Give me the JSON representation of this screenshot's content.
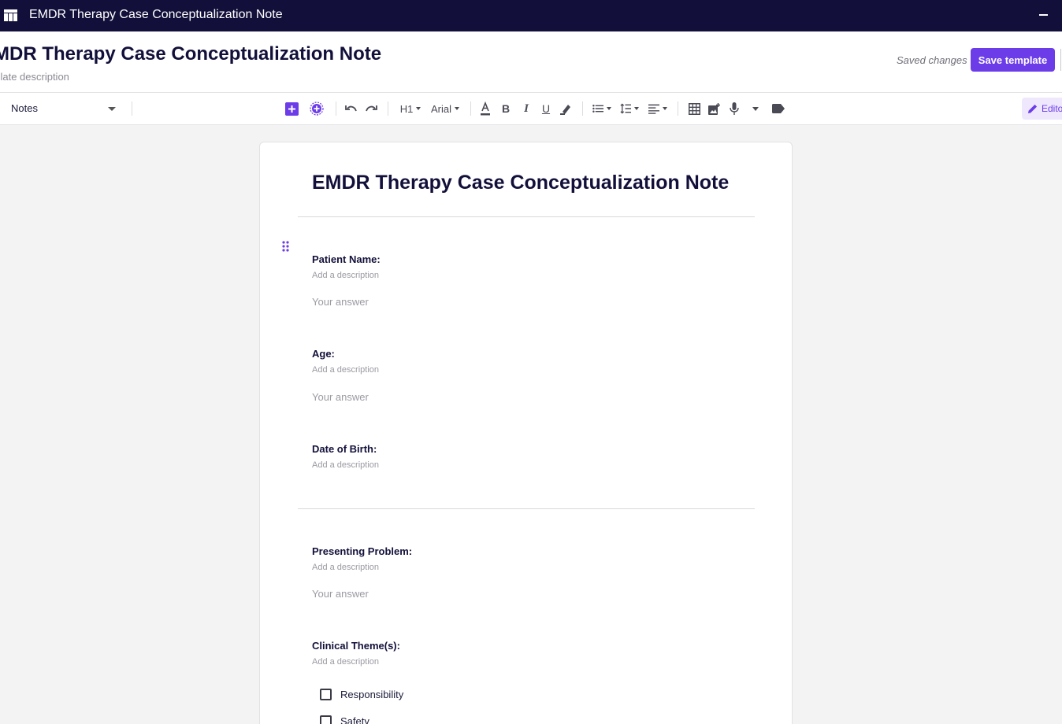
{
  "titlebar": {
    "title": "EMDR Therapy Case Conceptualization Note",
    "icon": "app-grid-icon"
  },
  "header": {
    "doc_title": "MDR Therapy Case Conceptualization Note",
    "doc_description": "nplate description",
    "status": "Saved changes",
    "save_label": "Save template"
  },
  "toolbar": {
    "section_select": "Notes",
    "heading": "H1",
    "font": "Arial",
    "editor_label": "Edito",
    "accent_color": "#6c3ce9"
  },
  "document": {
    "title": "EMDR Therapy Case Conceptualization Note",
    "fields": [
      {
        "label": "Patient Name:",
        "description": "Add a description",
        "answer": "Your answer"
      },
      {
        "label": "Age:",
        "description": "Add a description",
        "answer": "Your answer"
      },
      {
        "label": "Date of Birth:",
        "description": "Add a description"
      },
      {
        "label": "Presenting Problem:",
        "description": "Add a description",
        "answer": "Your answer"
      },
      {
        "label": "Clinical Theme(s):",
        "description": "Add a description"
      }
    ],
    "options": [
      "Responsibility",
      "Safety"
    ]
  }
}
